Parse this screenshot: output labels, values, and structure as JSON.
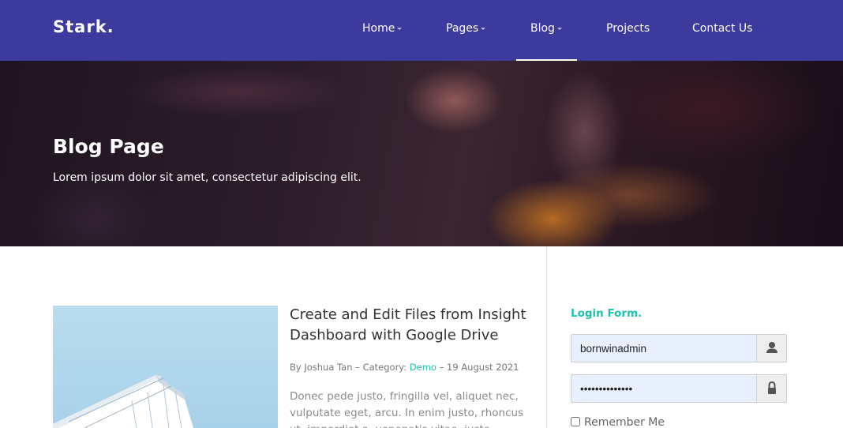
{
  "header": {
    "brand": "Stark.",
    "nav": [
      {
        "label": "Home"
      },
      {
        "label": "Pages"
      },
      {
        "label": "Blog"
      },
      {
        "label": "Projects"
      },
      {
        "label": "Contact Us"
      }
    ]
  },
  "hero": {
    "title": "Blog Page",
    "subtitle": "Lorem ipsum dolor sit amet, consectetur adipiscing elit."
  },
  "post": {
    "title": "Create and Edit Files from Insight Dashboard with Google Drive",
    "meta_prefix": "By Joshua Tan – Category: ",
    "category": "Demo",
    "meta_suffix": " – 19 August 2021",
    "excerpt": "Donec pede justo, fringilla vel, aliquet nec, vulputate eget, arcu. In enim justo, rhoncus ut, imperdiet a, venenatis vitae, justo."
  },
  "sidebar": {
    "login": {
      "heading": "Login Form.",
      "username_value": "bornwinadmin",
      "password_value": "••••••••••••••",
      "remember_label": "Remember Me"
    }
  },
  "colors": {
    "navbar": "#3d3a9e",
    "accent": "#1fc3ad"
  },
  "icons": {
    "user": "user-icon",
    "password": "lock-icon",
    "dropdown": "caret-down-icon"
  }
}
